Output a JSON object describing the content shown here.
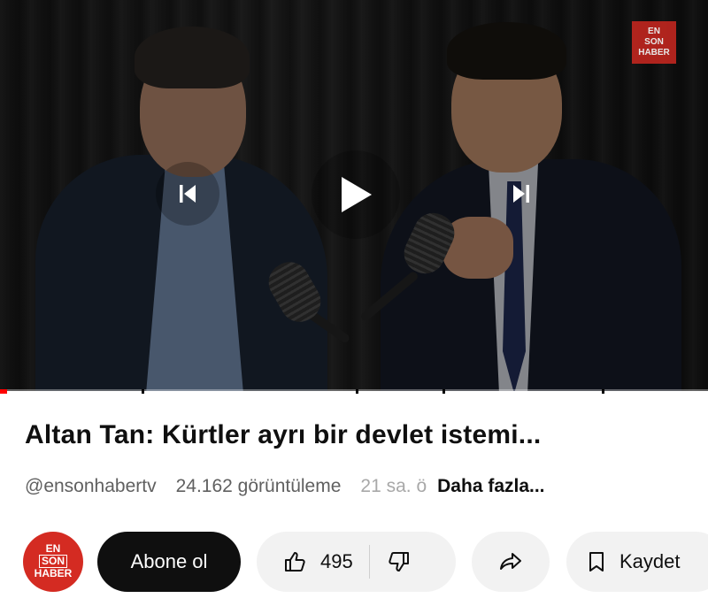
{
  "player": {
    "channel_logo": {
      "line1": "EN",
      "line2": "SON",
      "line3": "HABER"
    },
    "controls": {
      "prev_icon": "skip-previous-icon",
      "play_icon": "play-icon",
      "next_icon": "skip-next-icon"
    },
    "progress_fraction": 0.01
  },
  "video": {
    "title": "Altan Tan: Kürtler ayrı bir devlet istemi...",
    "channel_handle": "@ensonhabertv",
    "views": "24.162 görüntüleme",
    "age": "21 sa. ö",
    "more_label": "Daha fazla..."
  },
  "actions": {
    "avatar": {
      "line1": "EN",
      "line2": "SON",
      "line3": "HABER"
    },
    "subscribe_label": "Abone ol",
    "like_count": "495",
    "save_label": "Kaydet"
  },
  "colors": {
    "brand_red": "#d42b22",
    "progress_red": "#ff0000",
    "subscribe_bg": "#0f0f0f"
  }
}
